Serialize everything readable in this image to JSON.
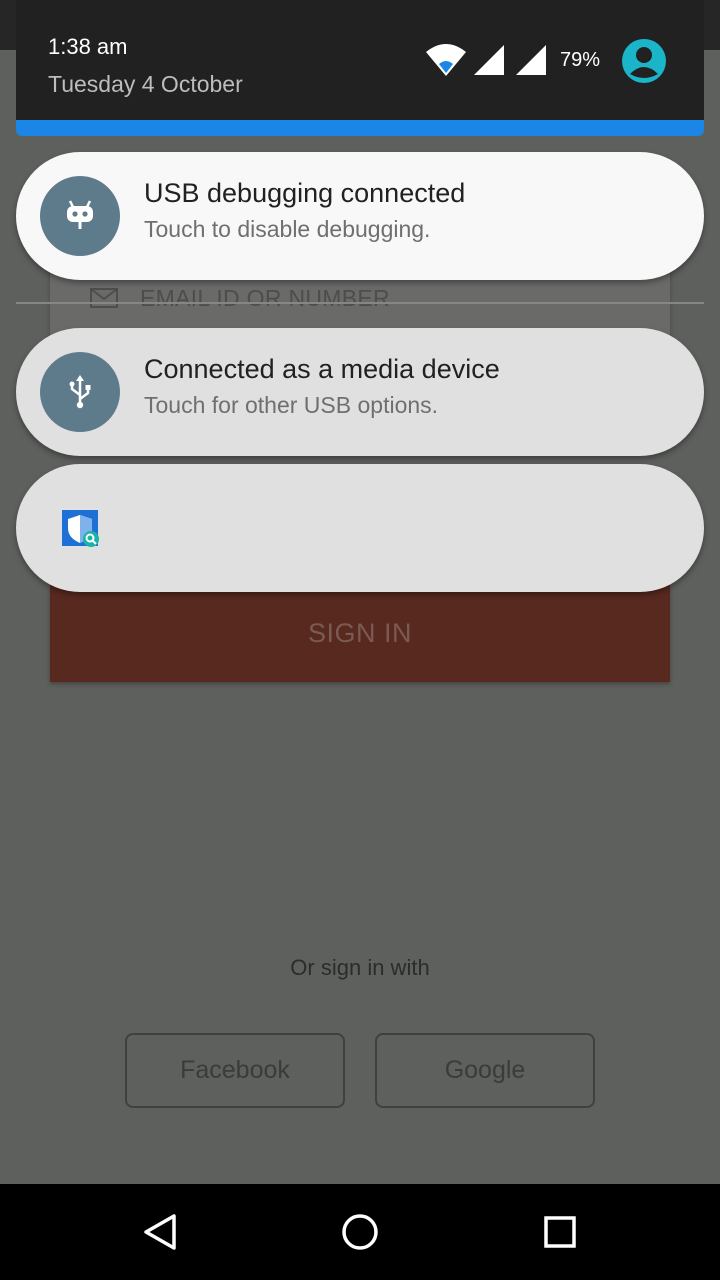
{
  "status": {
    "time": "1:38 am",
    "date": "Tuesday 4 October",
    "battery": "79%",
    "icons": [
      "wifi-icon",
      "signal-icon",
      "signal-icon",
      "avatar-icon"
    ]
  },
  "notifications": [
    {
      "title": "USB debugging connected",
      "subtitle": "Touch to disable debugging.",
      "icon": "cyanogen-bot-icon"
    },
    {
      "title": "Connected as a media device",
      "subtitle": "Touch for other USB options.",
      "icon": "usb-icon"
    },
    {
      "title": "",
      "subtitle": "",
      "icon": "security-shield-icon"
    }
  ],
  "login": {
    "email_placeholder": "EMAIL ID OR NUMBER",
    "signin_label": "SIGN IN",
    "or_text": "Or sign in with",
    "facebook_label": "Facebook",
    "google_label": "Google"
  },
  "colors": {
    "accent": "#1b86e6",
    "shade": "#212121",
    "notif_icon_bg": "#5e7b8c",
    "signin_bg": "#57291f",
    "avatar": "#1ab5c9"
  },
  "navbar": {
    "icons": [
      "back-icon",
      "home-icon",
      "recents-icon"
    ]
  }
}
